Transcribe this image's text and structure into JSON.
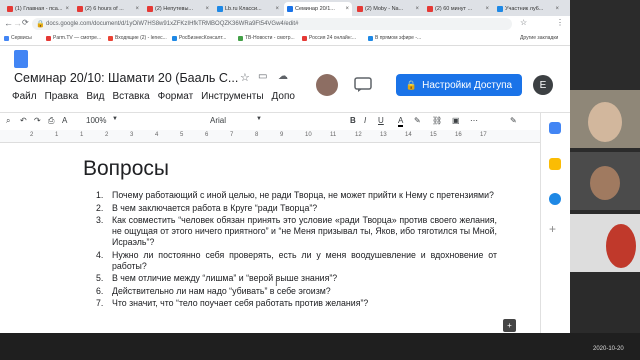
{
  "browser": {
    "tabs": [
      {
        "label": "(1) Главная - пса...",
        "color": "#e53935"
      },
      {
        "label": "(2) 6 hours of ...",
        "color": "#e53935"
      },
      {
        "label": "(2) Непутевы...",
        "color": "#e53935"
      },
      {
        "label": "Lb.ru Класси...",
        "color": "#1e88e5"
      },
      {
        "label": "Семинар 20/1...",
        "color": "#1a73e8"
      },
      {
        "label": "(2) Moby - Na...",
        "color": "#e53935"
      },
      {
        "label": "(2) 60 минут ...",
        "color": "#e53935"
      },
      {
        "label": "Участник лу6...",
        "color": "#1e88e5"
      }
    ],
    "active_tab_index": 4,
    "url": "docs.google.com/document/d/1yOiW7HS8w91xZFKzIHfkTRMBOQZK36WRa9Ft54VGw4/edit#",
    "bookmarks": [
      {
        "label": "Сервисы",
        "color": "#4285f4"
      },
      {
        "label": "Parm.TV — смотре...",
        "color": "#e53935"
      },
      {
        "label": "Входящие (2) - lenec...",
        "color": "#ea4335"
      },
      {
        "label": "РосБизнесКонсалт...",
        "color": "#1e88e5"
      },
      {
        "label": "ТВ-Новости - смотр...",
        "color": "#43a047"
      },
      {
        "label": "Россия 24 онлайн:...",
        "color": "#e53935"
      },
      {
        "label": "В прямом эфире -...",
        "color": "#1e88e5"
      }
    ],
    "other_bookmarks": "Другие закладки"
  },
  "docs": {
    "title": "Семинар 20/10: Шамати 20 (Бааль С...",
    "menu": [
      "Файл",
      "Правка",
      "Вид",
      "Вставка",
      "Формат",
      "Инструменты",
      "Допо"
    ],
    "share_label": "Настройки Доступа",
    "avatar_letter": "E",
    "toolbar": {
      "zoom": "100%",
      "style": "",
      "font": "Arial"
    },
    "ruler_ticks": [
      "2",
      "1",
      "1",
      "2",
      "3",
      "4",
      "5",
      "6",
      "7",
      "8",
      "9",
      "10",
      "11",
      "12",
      "13",
      "14",
      "15",
      "16",
      "17"
    ],
    "heading": "Вопросы",
    "questions": [
      "Почему работающий с иной целью, не ради Творца, не может прийти к Нему с претензиями?",
      "В чем заключается работа в Круге “ради Творца”?",
      "Как совместить “человек обязан принять это условие «ради Творца» против своего желания, не ощущая от этого ничего приятного” и “не Меня призывал ты, Яков, ибо тяготился ты Мной, Исраэль”?",
      "Нужно ли постоянно себя проверять, есть ли у меня воодушевление и вдохновение от работы?",
      "В чем отличие между “лишма” и “верой выше знания”?",
      "Действительно ли нам надо “убивать” в себе эгоизм?",
      "Что значит, что “тело поучает себя работать против желания”?"
    ]
  },
  "taskbar": {
    "clock": "2020-10-20"
  },
  "colors": {
    "accent": "#1a73e8"
  }
}
